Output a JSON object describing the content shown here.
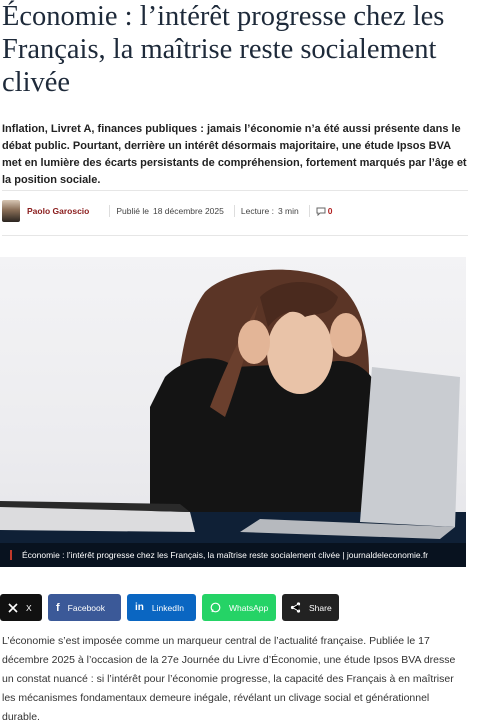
{
  "article": {
    "headline": "Économie : l’intérêt progresse chez les Français, la maîtrise reste socialement clivée",
    "lede": "Inflation, Livret A, finances publiques : jamais l’économie n’a été aussi présente dans le débat public. Pourtant, derrière un intérêt désormais majoritaire, une étude Ipsos BVA met en lumière des écarts persistants de compréhension, fortement marqués par l’âge et la position sociale.",
    "meta": {
      "author": "Paolo Garoscio",
      "published_label": "Publié le",
      "published_date": "18 décembre 2025",
      "reading_label": "Lecture :",
      "reading_time": "3 min",
      "comment_count": "0"
    },
    "image": {
      "caption": "Économie : l’intérêt progresse chez les Français, la maîtrise reste socialement clivée | journaldeleconomie.fr"
    },
    "share": {
      "x_label": "X",
      "facebook_label": "Facebook",
      "linkedin_label": "LinkedIn",
      "whatsapp_label": "WhatsApp",
      "share_label": "Share"
    },
    "body": "L’économie s’est imposée comme un marqueur central de l’actualité française. Publiée le 17 décembre 2025 à l’occasion de la 27e Journée du Livre d’Économie, une étude Ipsos BVA dresse un constat nuancé : si l’intérêt pour l’économie progresse, la capacité des Français à en maîtriser les mécanismes fondamentaux demeure inégale, révélant un clivage social et générationnel durable."
  },
  "colors": {
    "author": "#8a1c1c",
    "facebook": "#3b5998",
    "linkedin": "#0a66c2",
    "whatsapp": "#25d366",
    "x": "#111111",
    "share": "#222222"
  },
  "icons": {
    "avatar": "author-avatar",
    "comment": "comment-icon",
    "x": "x-logo-icon",
    "facebook": "facebook-icon",
    "linkedin": "linkedin-icon",
    "whatsapp": "whatsapp-icon",
    "share": "share-icon"
  }
}
